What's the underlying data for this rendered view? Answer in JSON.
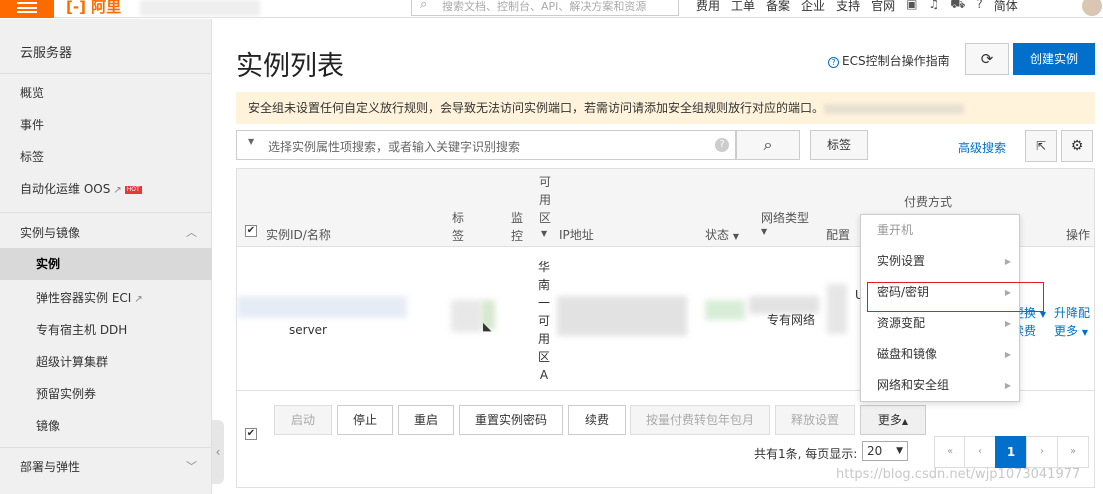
{
  "topbar": {
    "brand": "[-] 阿里",
    "search_placeholder": "搜索文档、控制台、API、解决方案和资源",
    "nav": [
      "费用",
      "工单",
      "备案",
      "企业",
      "支持",
      "官网"
    ],
    "lang": "简体",
    "icons": [
      "terminal-icon",
      "bell-icon",
      "cart-icon",
      "help-icon"
    ]
  },
  "sidebar": {
    "title": "云服务器",
    "items": [
      {
        "label": "概览"
      },
      {
        "label": "事件"
      },
      {
        "label": "标签"
      },
      {
        "label": "自动化运维 OOS",
        "badge": "HOT"
      },
      {
        "label": "实例与镜像"
      },
      {
        "label": "实例"
      },
      {
        "label": "弹性容器实例 ECI"
      },
      {
        "label": "专有宿主机 DDH"
      },
      {
        "label": "超级计算集群"
      },
      {
        "label": "预留实例券"
      },
      {
        "label": "镜像"
      },
      {
        "label": "部署与弹性"
      }
    ]
  },
  "header": {
    "title": "实例列表",
    "guide": "ECS控制台操作指南",
    "create": "创建实例"
  },
  "warning": {
    "text": "安全组未设置任何自定义放行规则，会导致无法访问实例端口，若需访问请添加安全组规则放行对应的端口。"
  },
  "filter": {
    "placeholder": "选择实例属性项搜索，或者输入关键字识别搜索",
    "tag": "标签",
    "advanced": "高级搜索"
  },
  "table": {
    "columns": {
      "id": "实例ID/名称",
      "tag": "标签",
      "monitor": "监控",
      "zone": "可用区",
      "ip": "IP地址",
      "status": "状态",
      "network": "网络类型",
      "config": "配置",
      "pay": "付费方式",
      "ops": "操作"
    },
    "row": {
      "name_fragment": "server",
      "zone": "华南一可用区A",
      "network": "专有网络",
      "ops_link1": "更换",
      "ops_link2": "升降配",
      "ops_link3": "续费",
      "ops_more": "更多",
      "pay_fragment": "U"
    }
  },
  "toolbar": {
    "buttons": [
      "启动",
      "停止",
      "重启",
      "重置实例密码",
      "续费",
      "按量付费转包年包月",
      "释放设置",
      "更多"
    ]
  },
  "pager": {
    "info": "共有1条, 每页显示:",
    "page_size": "20",
    "current": "1",
    "first": "«",
    "prev": "‹",
    "next": "›",
    "last": "»"
  },
  "dropdown": {
    "items": [
      "重开机",
      "实例设置",
      "密码/密钥",
      "资源变配",
      "磁盘和镜像",
      "网络和安全组"
    ]
  },
  "watermark": "https://blog.csdn.net/wjp1073041977"
}
